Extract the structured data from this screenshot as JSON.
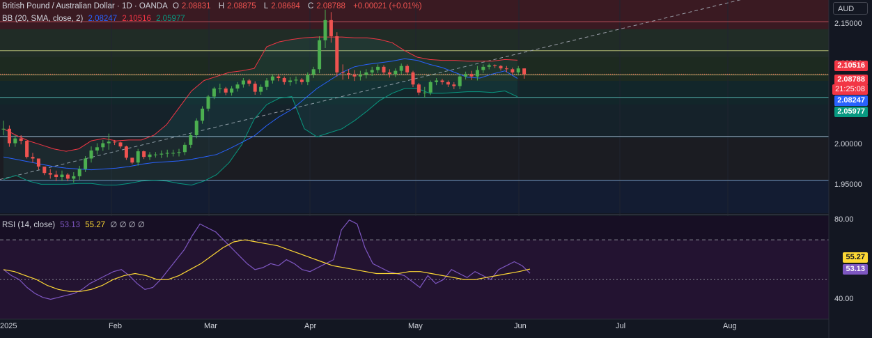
{
  "header": {
    "symbol": "British Pound / Australian Dollar · 1D · OANDA",
    "o_label": "O",
    "o": "2.08831",
    "h_label": "H",
    "h": "2.08875",
    "l_label": "L",
    "l": "2.08684",
    "c_label": "C",
    "c": "2.08788",
    "change": "+0.00021 (+0.01%)"
  },
  "bb_legend": {
    "label": "BB (20, SMA, close, 2)",
    "v1": "2.08247",
    "v2": "2.10516",
    "v3": "2.05977"
  },
  "rsi_legend": {
    "label": "RSI (14, close)",
    "v1": "53.13",
    "v2": "55.27",
    "rest": "∅ ∅ ∅ ∅"
  },
  "currency": "AUD",
  "badges": {
    "upper": "2.10516",
    "price": "2.08788",
    "countdown": "21:25:08",
    "basis": "2.08247",
    "lower": "2.05977",
    "rsi_ma": "55.27",
    "rsi": "53.13"
  },
  "colors": {
    "up": "#4caf50",
    "down": "#ef5350",
    "bb_basis": "#2962ff",
    "bb_upper": "#f23645",
    "bb_lower": "#089981",
    "rsi": "#7e57c2",
    "rsi_ma": "#fdd835"
  },
  "chart_data": [
    {
      "type": "candlestick",
      "title": "British Pound / Australian Dollar · 1D · OANDA",
      "y_ticks": [
        "2.15000",
        "2.10000",
        "2.05000",
        "2.00000",
        "1.95000"
      ],
      "ylim": [
        1.915,
        2.18
      ],
      "x_ticks": [
        "2025",
        "Feb",
        "Mar",
        "Apr",
        "May",
        "Jun",
        "Jul",
        "Aug"
      ],
      "horizontal_levels": [
        2.153,
        2.117,
        2.087,
        2.059,
        2.0105,
        1.956
      ],
      "candles": {
        "close": [
          2.02,
          2.002,
          2.008,
          2.005,
          1.985,
          1.983,
          1.973,
          1.965,
          1.963,
          1.96,
          1.963,
          1.958,
          1.961,
          1.97,
          1.983,
          1.993,
          1.997,
          2.002,
          2.004,
          2.003,
          1.998,
          1.984,
          1.978,
          1.992,
          1.985,
          1.988,
          1.988,
          1.989,
          1.99,
          1.99,
          1.991,
          2.0,
          2.012,
          2.03,
          2.045,
          2.06,
          2.07,
          2.07,
          2.065,
          2.07,
          2.075,
          2.08,
          2.076,
          2.066,
          2.072,
          2.08,
          2.085,
          2.083,
          2.078,
          2.08,
          2.081,
          2.078,
          2.087,
          2.094,
          2.13,
          2.155,
          2.135,
          2.09,
          2.089,
          2.087,
          2.085,
          2.087,
          2.09,
          2.093,
          2.097,
          2.09,
          2.088,
          2.092,
          2.098,
          2.09,
          2.075,
          2.065,
          2.065,
          2.078,
          2.08,
          2.078,
          2.075,
          2.073,
          2.085,
          2.088,
          2.085,
          2.093,
          2.097,
          2.099,
          2.098,
          2.095,
          2.094,
          2.09,
          2.095,
          2.0879
        ],
        "hi": [
          2.03,
          2.024,
          2.012,
          2.012,
          2.005,
          1.99,
          1.98,
          1.972,
          1.97,
          1.968,
          1.968,
          1.965,
          1.966,
          1.974,
          1.986,
          1.998,
          2.002,
          2.006,
          2.014,
          2.006,
          2.004,
          1.999,
          1.984,
          1.995,
          1.993,
          1.991,
          1.991,
          1.993,
          1.994,
          1.994,
          1.995,
          2.003,
          2.015,
          2.033,
          2.048,
          2.062,
          2.072,
          2.076,
          2.072,
          2.073,
          2.078,
          2.083,
          2.082,
          2.079,
          2.075,
          2.083,
          2.088,
          2.088,
          2.085,
          2.084,
          2.085,
          2.083,
          2.09,
          2.097,
          2.135,
          2.168,
          2.165,
          2.14,
          2.1,
          2.094,
          2.093,
          2.092,
          2.094,
          2.097,
          2.1,
          2.099,
          2.094,
          2.095,
          2.101,
          2.1,
          2.092,
          2.077,
          2.072,
          2.08,
          2.083,
          2.082,
          2.08,
          2.078,
          2.088,
          2.091,
          2.092,
          2.098,
          2.1,
          2.101,
          2.1,
          2.099,
          2.098,
          2.096,
          2.098,
          2.0888
        ]
      },
      "bb_basis": [
        1.985,
        1.982,
        1.979,
        1.976,
        1.973,
        1.971,
        1.97,
        1.969,
        1.97,
        1.971,
        1.973,
        1.976,
        1.978,
        1.979,
        1.98,
        1.982,
        1.985,
        1.988,
        1.995,
        2.003,
        2.011,
        2.024,
        2.035,
        2.044,
        2.057,
        2.07,
        2.08,
        2.09,
        2.097,
        2.1,
        2.102,
        2.104,
        2.107,
        2.105,
        2.1,
        2.096,
        2.09,
        2.084,
        2.083,
        2.088,
        2.092,
        2.0825
      ],
      "bb_upper": [
        2.02,
        2.012,
        2.005,
        2.0,
        1.995,
        1.992,
        1.995,
        2.005,
        2.008,
        2.005,
        2.006,
        2.006,
        2.012,
        2.025,
        2.046,
        2.067,
        2.08,
        2.085,
        2.09,
        2.092,
        2.095,
        2.122,
        2.128,
        2.131,
        2.133,
        2.134,
        2.134,
        2.134,
        2.133,
        2.133,
        2.131,
        2.127,
        2.117,
        2.109,
        2.106,
        2.105,
        2.105,
        2.104,
        2.104,
        2.104,
        2.106,
        2.1052
      ],
      "bb_lower": [
        1.957,
        1.962,
        1.955,
        1.951,
        1.951,
        1.951,
        1.952,
        1.952,
        1.95,
        1.95,
        1.952,
        1.955,
        1.956,
        1.955,
        1.952,
        1.95,
        1.955,
        1.963,
        1.978,
        2.0,
        2.032,
        2.05,
        2.058,
        2.06,
        2.02,
        2.01,
        2.015,
        2.02,
        2.03,
        2.042,
        2.055,
        2.064,
        2.07,
        2.07,
        2.064,
        2.064,
        2.065,
        2.066,
        2.066,
        2.065,
        2.067,
        2.0598
      ]
    },
    {
      "type": "line",
      "title": "RSI (14, close)",
      "y_ticks": [
        "80.00",
        "40.00"
      ],
      "ylim": [
        30,
        82
      ],
      "bands": [
        70,
        50,
        30
      ],
      "series": [
        {
          "name": "RSI",
          "values": [
            55,
            52,
            50,
            46,
            43,
            41,
            40,
            41,
            42,
            43,
            45,
            48,
            50,
            52,
            54,
            55,
            52,
            48,
            45,
            46,
            50,
            55,
            60,
            65,
            72,
            78,
            76,
            74,
            70,
            66,
            62,
            58,
            55,
            56,
            58,
            57,
            60,
            58,
            55,
            54,
            56,
            58,
            60,
            75,
            80,
            78,
            66,
            58,
            56,
            54,
            53,
            52,
            49,
            46,
            52,
            48,
            50,
            55,
            53,
            51,
            54,
            52,
            50,
            55,
            57,
            59,
            57,
            53.13
          ]
        },
        {
          "name": "RSI-based MA",
          "values": [
            55,
            54,
            52,
            50,
            47,
            45,
            44,
            44,
            45,
            47,
            50,
            52,
            53,
            52,
            50,
            50,
            52,
            55,
            58,
            62,
            66,
            69,
            70,
            69,
            68,
            67,
            65,
            63,
            61,
            59,
            57,
            56,
            55,
            54,
            53,
            53,
            53,
            54,
            54,
            53,
            52,
            51,
            50,
            50,
            51,
            52,
            53,
            54,
            55.27
          ]
        }
      ]
    }
  ]
}
